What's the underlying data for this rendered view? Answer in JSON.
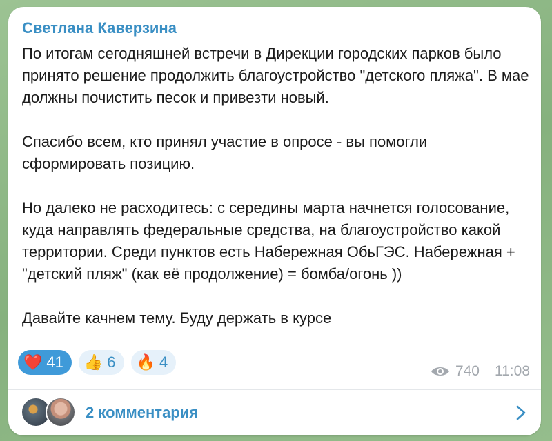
{
  "message": {
    "author": "Светлана Каверзина",
    "paragraphs": [
      "По итогам сегодняшней встречи в Дирекции городских парков было принято решение продолжить благоустройство \"детского пляжа\". В мае должны почистить песок и привезти новый.",
      "Спасибо всем, кто принял участие в опросе - вы помогли сформировать позицию.",
      "Но далеко не расходитесь: с середины марта начнется голосование, куда направлять федеральные средства, на благоустройство какой территории. Среди пунктов есть Набережная ОбьГЭС. Набережная + \"детский пляж\" (как её продолжение) = бомба/огонь ))",
      "Давайте качнем тему. Буду держать в курсе"
    ],
    "reactions": [
      {
        "emoji": "❤️",
        "icon": "heart-icon",
        "count": "41",
        "active": true
      },
      {
        "emoji": "👍",
        "icon": "thumbs-up-icon",
        "count": "6",
        "active": false
      },
      {
        "emoji": "🔥",
        "icon": "fire-icon",
        "count": "4",
        "active": false
      }
    ],
    "views": "740",
    "time": "11:08"
  },
  "comments": {
    "label": "2 комментария"
  },
  "colors": {
    "accent": "#3a8fc4",
    "active_reaction": "#3f9ad9",
    "meta": "#a3a8ae",
    "background": "#8fb88a"
  }
}
